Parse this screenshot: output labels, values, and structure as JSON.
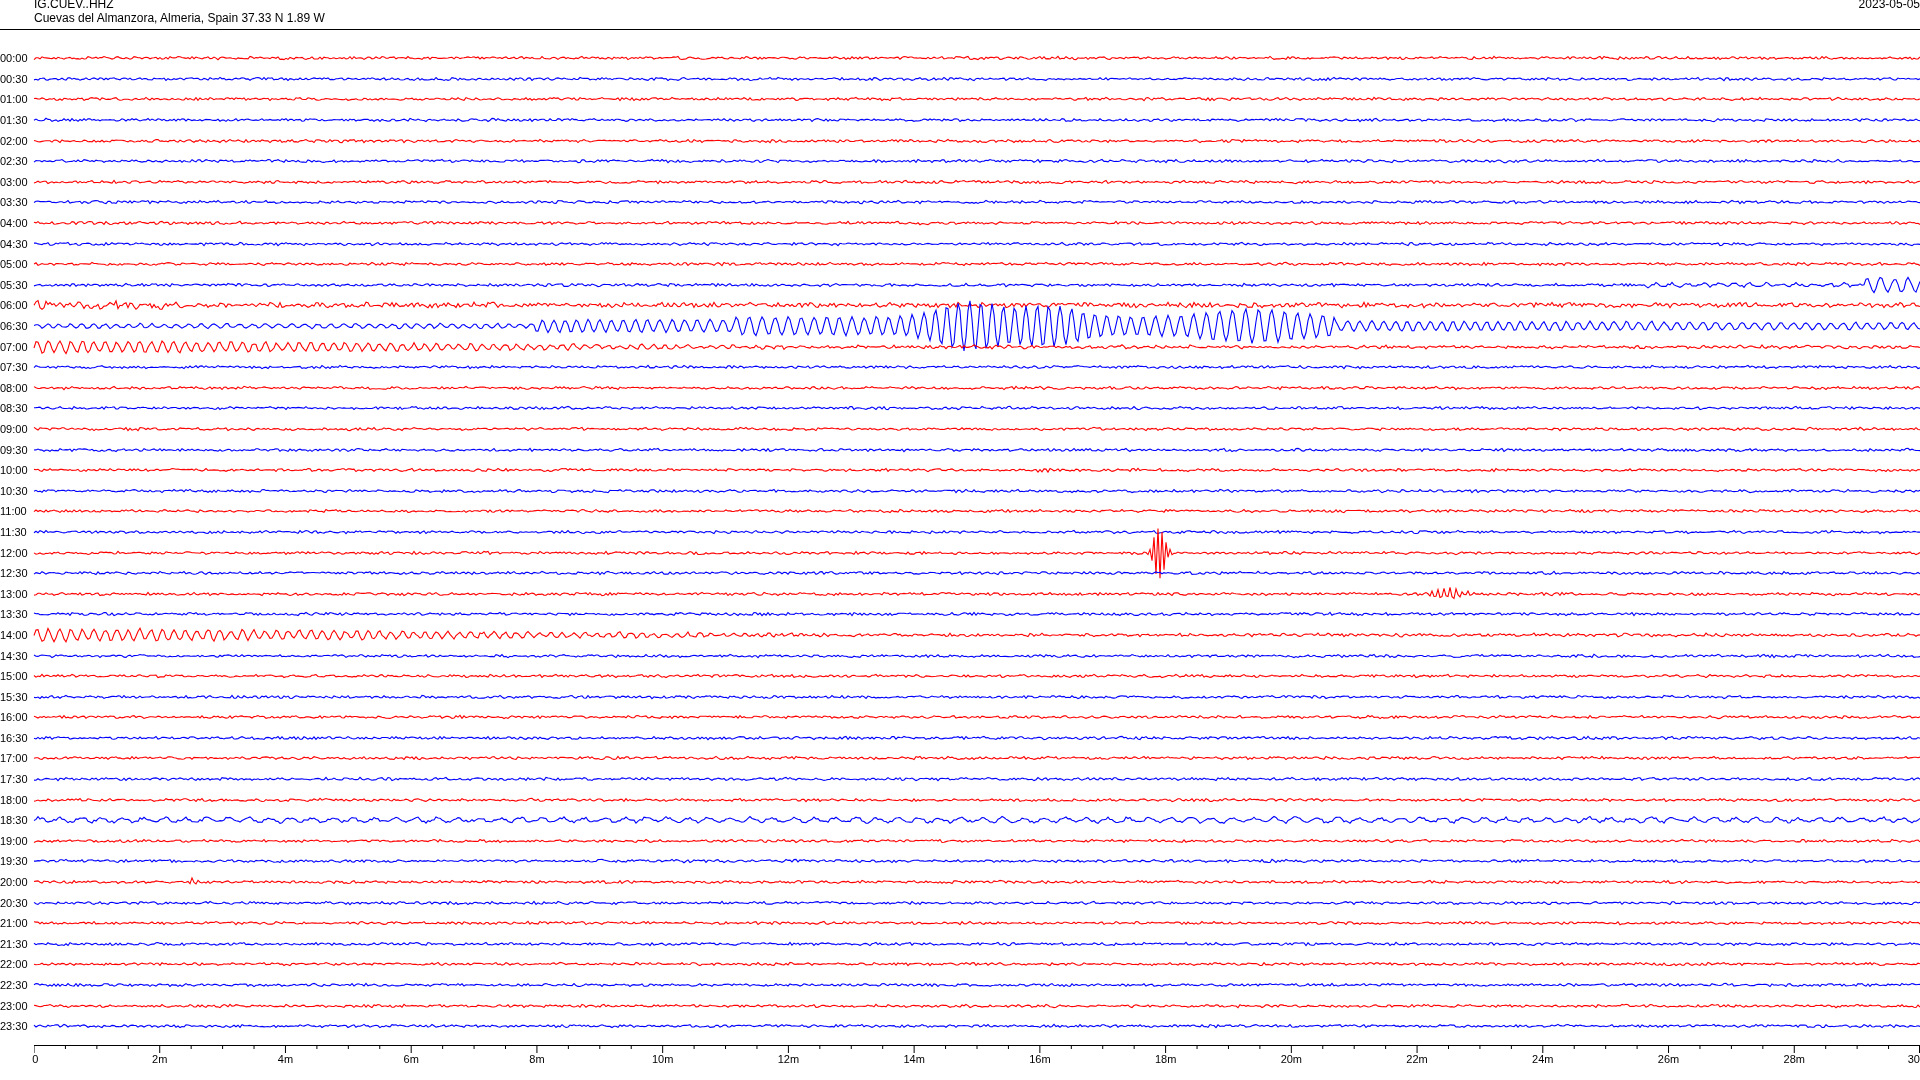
{
  "header": {
    "station": "IG.CUEV..HHZ",
    "location": "Cuevas del Almanzora, Almeria, Spain  37.33 N 1.89 W",
    "date": "2023-05-05"
  },
  "traces": [
    {
      "time": "00:00",
      "color": "#ff0000",
      "kind": "quiet"
    },
    {
      "time": "00:30",
      "color": "#0000ff",
      "kind": "quiet"
    },
    {
      "time": "01:00",
      "color": "#ff0000",
      "kind": "quiet"
    },
    {
      "time": "01:30",
      "color": "#0000ff",
      "kind": "quiet"
    },
    {
      "time": "02:00",
      "color": "#ff0000",
      "kind": "quiet"
    },
    {
      "time": "02:30",
      "color": "#0000ff",
      "kind": "quiet"
    },
    {
      "time": "03:00",
      "color": "#ff0000",
      "kind": "quiet"
    },
    {
      "time": "03:30",
      "color": "#0000ff",
      "kind": "quiet"
    },
    {
      "time": "04:00",
      "color": "#ff0000",
      "kind": "quiet"
    },
    {
      "time": "04:30",
      "color": "#0000ff",
      "kind": "quiet"
    },
    {
      "time": "05:00",
      "color": "#ff0000",
      "kind": "quiet"
    },
    {
      "time": "05:30",
      "color": "#0000ff",
      "kind": "onset"
    },
    {
      "time": "06:00",
      "color": "#ff0000",
      "kind": "noisy"
    },
    {
      "time": "06:30",
      "color": "#0000ff",
      "kind": "quake"
    },
    {
      "time": "07:00",
      "color": "#ff0000",
      "kind": "swell"
    },
    {
      "time": "07:30",
      "color": "#0000ff",
      "kind": "quiet"
    },
    {
      "time": "08:00",
      "color": "#ff0000",
      "kind": "quiet"
    },
    {
      "time": "08:30",
      "color": "#0000ff",
      "kind": "quiet"
    },
    {
      "time": "09:00",
      "color": "#ff0000",
      "kind": "quiet"
    },
    {
      "time": "09:30",
      "color": "#0000ff",
      "kind": "quiet"
    },
    {
      "time": "10:00",
      "color": "#ff0000",
      "kind": "blip"
    },
    {
      "time": "10:30",
      "color": "#0000ff",
      "kind": "quiet"
    },
    {
      "time": "11:00",
      "color": "#ff0000",
      "kind": "quiet"
    },
    {
      "time": "11:30",
      "color": "#0000ff",
      "kind": "quiet"
    },
    {
      "time": "12:00",
      "color": "#ff0000",
      "kind": "spike"
    },
    {
      "time": "12:30",
      "color": "#0000ff",
      "kind": "quiet"
    },
    {
      "time": "13:00",
      "color": "#ff0000",
      "kind": "burst"
    },
    {
      "time": "13:30",
      "color": "#0000ff",
      "kind": "quiet"
    },
    {
      "time": "14:00",
      "color": "#ff0000",
      "kind": "swell"
    },
    {
      "time": "14:30",
      "color": "#0000ff",
      "kind": "quiet"
    },
    {
      "time": "15:00",
      "color": "#ff0000",
      "kind": "quiet"
    },
    {
      "time": "15:30",
      "color": "#0000ff",
      "kind": "quiet"
    },
    {
      "time": "16:00",
      "color": "#ff0000",
      "kind": "quiet"
    },
    {
      "time": "16:30",
      "color": "#0000ff",
      "kind": "quiet"
    },
    {
      "time": "17:00",
      "color": "#ff0000",
      "kind": "quiet"
    },
    {
      "time": "17:30",
      "color": "#0000ff",
      "kind": "quiet"
    },
    {
      "time": "18:00",
      "color": "#ff0000",
      "kind": "quiet"
    },
    {
      "time": "18:30",
      "color": "#0000ff",
      "kind": "wavy"
    },
    {
      "time": "19:00",
      "color": "#ff0000",
      "kind": "quiet"
    },
    {
      "time": "19:30",
      "color": "#0000ff",
      "kind": "quiet"
    },
    {
      "time": "20:00",
      "color": "#ff0000",
      "kind": "early-blip"
    },
    {
      "time": "20:30",
      "color": "#0000ff",
      "kind": "quiet"
    },
    {
      "time": "21:00",
      "color": "#ff0000",
      "kind": "quiet"
    },
    {
      "time": "21:30",
      "color": "#0000ff",
      "kind": "quiet"
    },
    {
      "time": "22:00",
      "color": "#ff0000",
      "kind": "quiet"
    },
    {
      "time": "22:30",
      "color": "#0000ff",
      "kind": "quiet"
    },
    {
      "time": "23:00",
      "color": "#ff0000",
      "kind": "quiet"
    },
    {
      "time": "23:30",
      "color": "#0000ff",
      "kind": "quiet"
    }
  ],
  "axis": {
    "labels": [
      "0",
      "2m",
      "4m",
      "6m",
      "8m",
      "10m",
      "12m",
      "14m",
      "16m",
      "18m",
      "20m",
      "22m",
      "24m",
      "26m",
      "28m",
      "30"
    ]
  }
}
